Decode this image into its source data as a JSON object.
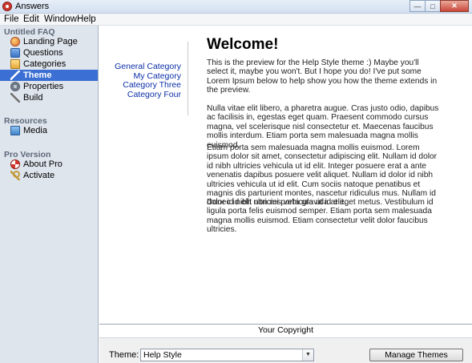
{
  "window": {
    "title": "Answers"
  },
  "menu": [
    "File",
    "Edit",
    "Window",
    "Help"
  ],
  "sidebar": {
    "sections": [
      {
        "title": "Untitled FAQ",
        "items": [
          {
            "label": "Landing Page",
            "icon": "globe-icon"
          },
          {
            "label": "Questions",
            "icon": "questions-icon"
          },
          {
            "label": "Categories",
            "icon": "categories-icon"
          },
          {
            "label": "Theme",
            "icon": "theme-brush-icon",
            "selected": true
          },
          {
            "label": "Properties",
            "icon": "properties-gear-icon"
          },
          {
            "label": "Build",
            "icon": "build-wrench-icon"
          }
        ]
      },
      {
        "title": "Resources",
        "items": [
          {
            "label": "Media",
            "icon": "media-icon"
          }
        ]
      },
      {
        "title": "Pro Version",
        "items": [
          {
            "label": "About Pro",
            "icon": "lifebuoy-icon"
          },
          {
            "label": "Activate",
            "icon": "key-icon"
          }
        ]
      }
    ]
  },
  "preview": {
    "categories": [
      "General Category",
      "My Category",
      "Category Three",
      "Category Four"
    ],
    "heading": "Welcome!",
    "paragraphs": [
      "This is the preview for the Help Style theme :) Maybe you'll select it, maybe you won't. But I hope you do! I've put some Lorem Ipsum below to help show you how the theme extends in the preview.",
      "Nulla vitae elit libero, a pharetra augue. Cras justo odio, dapibus ac facilisis in, egestas eget quam. Praesent commodo cursus magna, vel scelerisque nisl consectetur et. Maecenas faucibus mollis interdum. Etiam porta sem malesuada magna mollis euismod.",
      "Etiam porta sem malesuada magna mollis euismod. Lorem ipsum dolor sit amet, consectetur adipiscing elit. Nullam id dolor id nibh ultricies vehicula ut id elit. Integer posuere erat a ante venenatis dapibus posuere velit aliquet. Nullam id dolor id nibh ultricies vehicula ut id elit. Cum sociis natoque penatibus et magnis dis parturient montes, nascetur ridiculus mus. Nullam id dolor id nibh ultricies vehicula ut id elit.",
      "Donec id elit non mi porta gravida at eget metus. Vestibulum id ligula porta felis euismod semper. Etiam porta sem malesuada magna mollis euismod. Etiam consectetur velit dolor faucibus ultricies."
    ],
    "footer": "Your Copyright"
  },
  "bottom": {
    "theme_label": "Theme:",
    "theme_value": "Help Style",
    "manage_button": "Manage Themes"
  },
  "colors": {
    "selection": "#3b6fd3",
    "link": "#0b2fa8",
    "sidebar_bg": "#dfe5ed"
  }
}
